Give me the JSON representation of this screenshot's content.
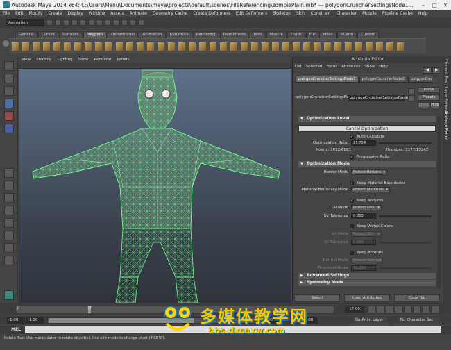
{
  "window": {
    "title": "Autodesk Maya 2014 x64: C:\\Users\\Manu\\Documents\\maya\\projects\\default\\scenes\\FileReferencing\\zombiePlain.mb*   ---   polygonCruncherSettingsNode1..."
  },
  "menubar": [
    "File",
    "Edit",
    "Modify",
    "Create",
    "Display",
    "Window",
    "Assets",
    "Animate",
    "Geometry Cache",
    "Create Deformers",
    "Edit Deformers",
    "Skeleton",
    "Skin",
    "Constrain",
    "Character",
    "Muscle",
    "Pipeline Cache",
    "Help"
  ],
  "status": {
    "mode": "Animation"
  },
  "shelf": {
    "tabs": [
      "General",
      "Curves",
      "Surfaces",
      "Polygons",
      "Deformation",
      "Animation",
      "Dynamics",
      "Rendering",
      "PaintEffects",
      "Toon",
      "Muscle",
      "Fluids",
      "Fur",
      "nHair",
      "nCloth",
      "Custom"
    ],
    "active": "Polygons"
  },
  "viewport": {
    "menu": [
      "View",
      "Shading",
      "Lighting",
      "Show",
      "Renderer",
      "Panels"
    ]
  },
  "attribute_editor": {
    "title": "Attribute Editor",
    "menu": [
      "List",
      "Selected",
      "Focus",
      "Attributes",
      "Show",
      "Help"
    ],
    "tabs": [
      "polygonCruncherSettingsNode1",
      "polygonCruncherNode2",
      "polygonCru"
    ],
    "node_label": "polygonCruncherSettingsNode:",
    "node_value": "polygonCruncherSettingsNode1",
    "buttons": {
      "focus": "Focus",
      "presets": "Presets",
      "show": "Show",
      "hide": "Hide"
    },
    "optimization_level": {
      "header": "Optimization Level",
      "cancel": "Cancel Optimization",
      "auto_calc": "Auto Calculate",
      "ratio_label": "Optimization Ratio",
      "ratio_value": "11.724",
      "points": "Points: 1612/6881",
      "triangles": "Triangles: 3177/13242",
      "progressive": "Progressive Ratio"
    },
    "optimization_mode": {
      "header": "Optimization Mode",
      "border_mode_label": "Border Mode",
      "border_mode_value": "Protect Borders",
      "keep_material": "Keep Material Boundaries",
      "material_mode_label": "Material Boundary Mode",
      "material_mode_value": "Protect Materials",
      "keep_textures": "Keep Textures",
      "uv_mode_label": "Uv Mode",
      "uv_mode_value": "Protect UVs",
      "uv_tol_label": "Uv Tolerance",
      "uv_tol_value": "0.000",
      "keep_vertex_colors": "Keep Vertex Colors",
      "vc_mode_label": "Vc Mode",
      "vc_mode_value": "Protect VCs",
      "vc_tol_label": "Vc Tolerance",
      "vc_tol_value": "0.000",
      "keep_normals": "Keep Normals",
      "normal_mode_label": "Normal Mode",
      "normal_mode_value": "Protect Normals",
      "threshold_label": "Threshold Angle",
      "threshold_value": "30.000"
    },
    "advanced": "Advanced Settings",
    "symmetry": "Symmetry Mode",
    "bottom": {
      "select": "Select",
      "load": "Load Attributes",
      "copy": "Copy Tab"
    }
  },
  "sidebar": [
    "Channel Box / Layer Editor",
    "Attribute Editor"
  ],
  "timeslider": {
    "ticks": [
      "1",
      "",
      "",
      "",
      "",
      "",
      "",
      "37",
      "",
      "",
      "",
      "",
      "",
      "",
      "",
      "",
      "",
      "",
      ""
    ],
    "current_frame": "17.00",
    "marker": "37"
  },
  "rangeslider": {
    "start": "-1.00",
    "start2": "-1.00",
    "end": "160.00",
    "end2": "160.00",
    "end_inner": "160",
    "anim_layer": "No Anim Layer",
    "char_set": "No Character Set"
  },
  "mel": {
    "label": "MEL"
  },
  "helpline": "Rotate Tool: Use manipulator to rotate object(s). Use edit mode to change pivot (INSERT).",
  "watermark": {
    "title": "多媒体教学网",
    "url": "bbs.dxsaxw.com"
  }
}
